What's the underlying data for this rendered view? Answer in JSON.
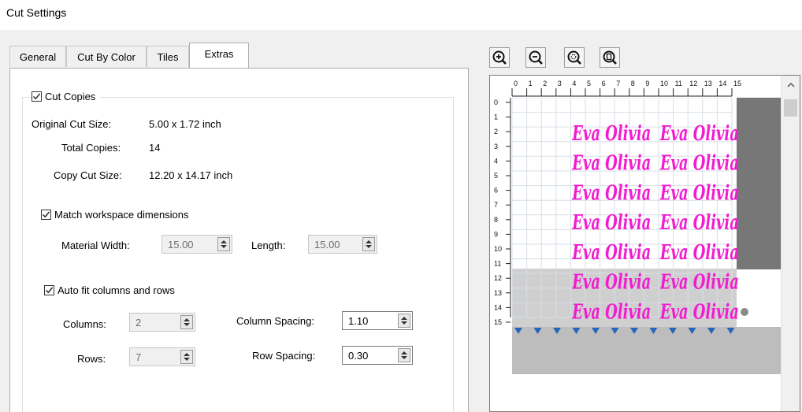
{
  "window": {
    "title": "Cut Settings"
  },
  "tabs": [
    "General",
    "Cut By Color",
    "Tiles",
    "Extras"
  ],
  "active_tab": "Extras",
  "cut_copies": {
    "label": "Cut Copies",
    "checked": true,
    "original_size_label": "Original Cut Size:",
    "original_size_value": "5.00 x 1.72 inch",
    "total_copies_label": "Total Copies:",
    "total_copies_value": "14",
    "copy_size_label": "Copy Cut Size:",
    "copy_size_value": "12.20 x 14.17 inch"
  },
  "workspace": {
    "label": "Match workspace dimensions",
    "checked": true,
    "width_label": "Material Width:",
    "width_value": "15.00",
    "length_label": "Length:",
    "length_value": "15.00"
  },
  "autofit": {
    "label": "Auto fit columns and rows",
    "checked": true,
    "columns_label": "Columns:",
    "columns_value": "2",
    "rows_label": "Rows:",
    "rows_value": "7",
    "col_spacing_label": "Column Spacing:",
    "col_spacing_value": "1.10",
    "row_spacing_label": "Row Spacing:",
    "row_spacing_value": "0.30"
  },
  "toolbar": {
    "icons": [
      "zoom-in-icon",
      "zoom-out-icon",
      "zoom-fit-icon",
      "zoom-page-icon"
    ]
  },
  "preview": {
    "ruler_top": [
      "0",
      "1",
      "2",
      "3",
      "4",
      "5",
      "6",
      "7",
      "8",
      "9",
      "10",
      "11",
      "12",
      "13",
      "14",
      "15"
    ],
    "ruler_left": [
      "0",
      "1",
      "2",
      "3",
      "4",
      "5",
      "6",
      "7",
      "8",
      "9",
      "10",
      "11",
      "12",
      "13",
      "14",
      "15"
    ],
    "design_text": "Eva Olivia",
    "design_color": "#f21bd0",
    "columns": 2,
    "rows": 7,
    "marker_color": "#2467b8",
    "marker_count": 12
  }
}
